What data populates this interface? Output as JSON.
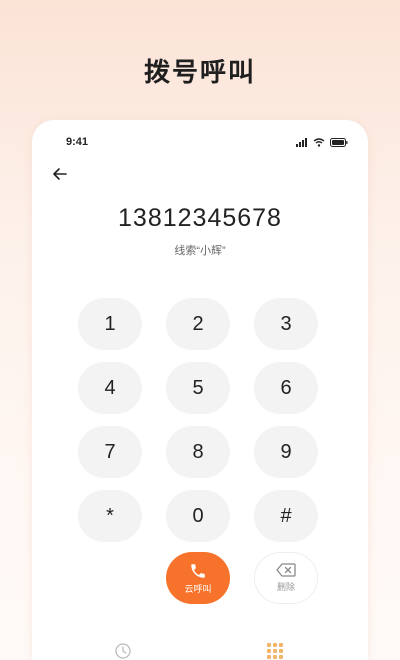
{
  "headline": "拨号呼叫",
  "status_bar": {
    "time": "9:41",
    "icons": [
      "signal-icon",
      "wifi-icon",
      "battery-icon"
    ]
  },
  "dialer": {
    "number": "13812345678",
    "hint": "线索“小辉”",
    "keys": [
      "1",
      "2",
      "3",
      "4",
      "5",
      "6",
      "7",
      "8",
      "9",
      "*",
      "0",
      "#"
    ]
  },
  "actions": {
    "call_label": "云呼叫",
    "delete_label": "删除"
  },
  "bottom_nav": {
    "icons": [
      "clock-icon",
      "dialpad-icon"
    ]
  },
  "colors": {
    "accent": "#f7722a",
    "key_bg": "#f3f3f3",
    "nav_active": "#f2b56a"
  }
}
